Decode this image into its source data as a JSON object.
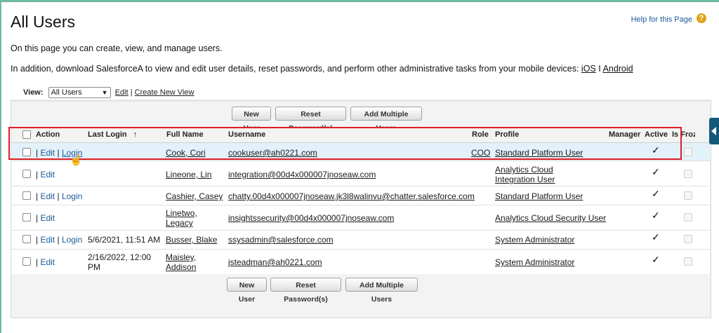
{
  "page": {
    "title": "All Users",
    "help_label": "Help for this Page",
    "help_icon": "question-icon",
    "intro_1": "On this page you can create, view, and manage users.",
    "intro_2_prefix": "In addition, download SalesforceA to view and edit user details, reset passwords, and perform other administrative tasks from your mobile devices:",
    "ios_link": "iOS",
    "separator": "I",
    "android_link": "Android"
  },
  "view": {
    "label": "View:",
    "selected": "All Users",
    "edit_link": "Edit",
    "create_link": "Create New View"
  },
  "buttons": {
    "new_user": "New User",
    "reset_password": "Reset Password(s)",
    "add_multiple": "Add Multiple Users"
  },
  "columns": {
    "action": "Action",
    "last_login": "Last Login",
    "sort_icon": "↑",
    "full_name": "Full Name",
    "username": "Username",
    "role": "Role",
    "profile": "Profile",
    "manager": "Manager",
    "active": "Active",
    "is_frozen": "Is Froz"
  },
  "rows": [
    {
      "edit": "Edit",
      "login": "Login",
      "last_login": "",
      "full_name": "Cook, Cori",
      "username": "cookuser@ah0221.com",
      "role": "COO",
      "profile": "Standard Platform User",
      "active": true
    },
    {
      "edit": "Edit",
      "login": "",
      "last_login": "",
      "full_name": "Lineone, Lin",
      "username": "integration@00d4x000007jnoseaw.com",
      "role": "",
      "profile": "Analytics Cloud Integration User",
      "active": true
    },
    {
      "edit": "Edit",
      "login": "Login",
      "last_login": "",
      "full_name": "Cashier, Casey",
      "username": "chatty.00d4x000007jnoseaw.jk3l8walinvu@chatter.salesforce.com",
      "role": "",
      "profile": "Standard Platform User",
      "active": true
    },
    {
      "edit": "Edit",
      "login": "",
      "last_login": "",
      "full_name": "Linetwo, Legacy",
      "username": "insightssecurity@00d4x000007jnoseaw.com",
      "role": "",
      "profile": "Analytics Cloud Security User",
      "active": true
    },
    {
      "edit": "Edit",
      "login": "Login",
      "last_login": "5/6/2021, 11:51 AM",
      "full_name": "Busser, Blake",
      "username": "ssysadmin@salesforce.com",
      "role": "",
      "profile": "System Administrator",
      "active": true
    },
    {
      "edit": "Edit",
      "login": "",
      "last_login": "2/16/2022, 12:00 PM",
      "full_name": "Maisley, Addison",
      "username": "jsteadman@ah0221.com",
      "role": "",
      "profile": "System Administrator",
      "active": true
    }
  ],
  "colors": {
    "link": "#1a5a96",
    "highlight_row": "#e3f1fb",
    "annotation_box": "#e01c24",
    "help_icon": "#e1a11a",
    "side_tab": "#14597a"
  },
  "icons": {
    "active_check": "✓",
    "side_tab": "chevron-left-icon",
    "cursor": "hand-cursor-icon"
  }
}
